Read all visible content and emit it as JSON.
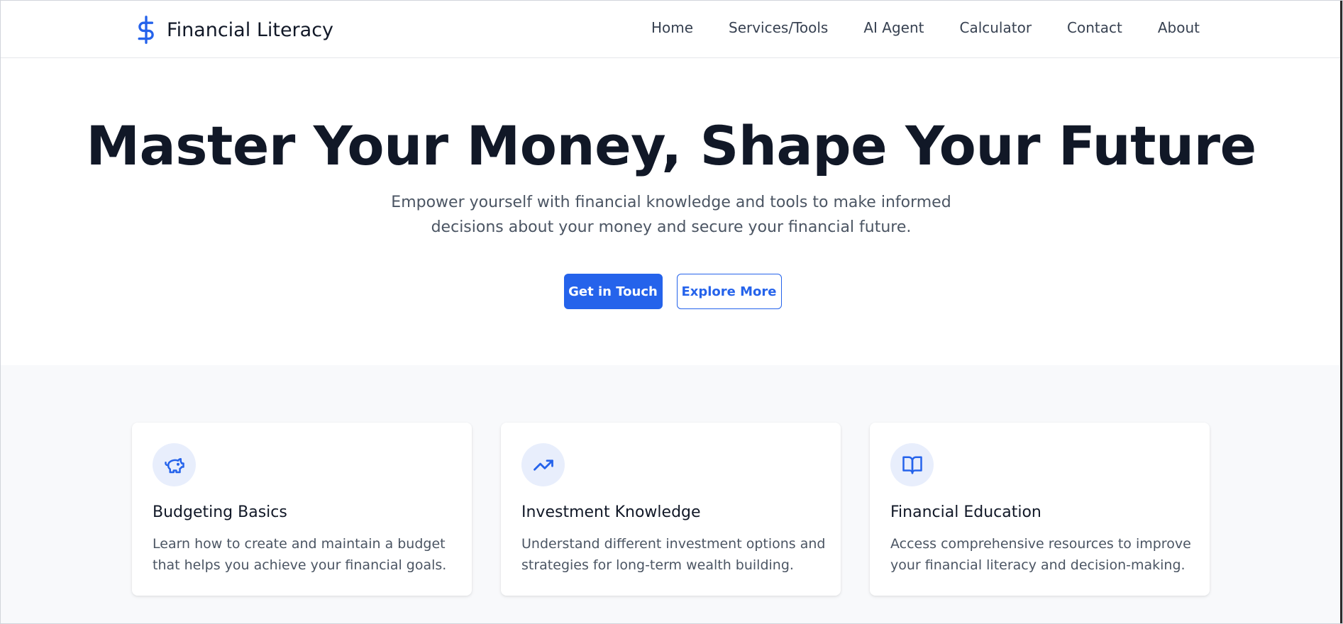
{
  "brand": {
    "name": "Financial Literacy",
    "logo_icon": "dollar-sign-icon",
    "accent_color": "#2563eb"
  },
  "nav": {
    "items": [
      {
        "label": "Home"
      },
      {
        "label": "Services/Tools"
      },
      {
        "label": "AI Agent"
      },
      {
        "label": "Calculator"
      },
      {
        "label": "Contact"
      },
      {
        "label": "About"
      }
    ]
  },
  "hero": {
    "title": "Master Your Money, Shape Your Future",
    "subtitle": "Empower yourself with financial knowledge and tools to make informed decisions about your money and secure your financial future.",
    "primary_button": "Get in Touch",
    "secondary_button": "Explore More"
  },
  "features": [
    {
      "icon": "piggy-bank-icon",
      "title": "Budgeting Basics",
      "text": "Learn how to create and maintain a budget that helps you achieve your financial goals."
    },
    {
      "icon": "trending-up-icon",
      "title": "Investment Knowledge",
      "text": "Understand different investment options and strategies for long-term wealth building."
    },
    {
      "icon": "open-book-icon",
      "title": "Financial Education",
      "text": "Access comprehensive resources to improve your financial literacy and decision-making."
    }
  ]
}
